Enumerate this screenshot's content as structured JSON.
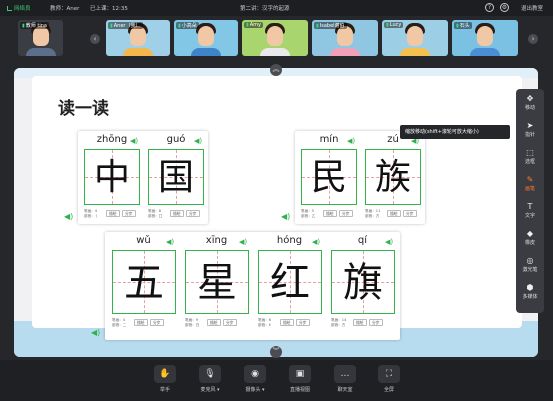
{
  "topbar": {
    "network": "网络良",
    "teacher": "教师：Aner",
    "elapsed": "已上课：12:35",
    "lesson": "第二讲：汉字的起源",
    "help_icon": "?",
    "settings_icon": "gear-icon",
    "exit": "退出教室"
  },
  "students": [
    {
      "name": "教师 tina",
      "shirt": "#5c6f8a",
      "bg": "#3b3d44"
    },
    {
      "name": "Aner（我）",
      "shirt": "#f2b84b",
      "bg": "#9fd0e8"
    },
    {
      "name": "小高朵",
      "shirt": "#3f83c9",
      "bg": "#83c7e6"
    },
    {
      "name": "Amy",
      "shirt": "#e9e9e9",
      "bg": "#a9d56e"
    },
    {
      "name": "Isabel谢伯",
      "shirt": "#f0a0b8",
      "bg": "#8fc6e2"
    },
    {
      "name": "Lucy",
      "shirt": "#f4c04e",
      "bg": "#9ccfe6"
    },
    {
      "name": "石头",
      "shirt": "#4a8fd6",
      "bg": "#7bc1e3"
    }
  ],
  "nav": {
    "prev": "‹",
    "next": "›"
  },
  "slide": {
    "title": "读一读",
    "cards": [
      {
        "cells": [
          {
            "pinyin": "zhōng",
            "char": "中"
          },
          {
            "pinyin": "guó",
            "char": "国"
          }
        ],
        "meta": [
          {
            "line1": "笔画：4",
            "line2": "部首：丨"
          },
          {
            "line1": "笔画：8",
            "line2": "部首：囗"
          }
        ]
      },
      {
        "cells": [
          {
            "pinyin": "mín",
            "char": "民"
          },
          {
            "pinyin": "zú",
            "char": "族"
          }
        ],
        "meta": [
          {
            "line1": "笔画：5",
            "line2": "部首：乙"
          },
          {
            "line1": "笔画：11",
            "line2": "部首：方"
          }
        ]
      },
      {
        "cells": [
          {
            "pinyin": "wǔ",
            "char": "五"
          },
          {
            "pinyin": "xīng",
            "char": "星"
          },
          {
            "pinyin": "hóng",
            "char": "红"
          },
          {
            "pinyin": "qí",
            "char": "旗"
          }
        ],
        "meta": [
          {
            "line1": "笔画：4",
            "line2": "部首：二"
          },
          {
            "line1": "笔画：9",
            "line2": "部首：日"
          },
          {
            "line1": "笔画：6",
            "line2": "部首：纟"
          },
          {
            "line1": "笔画：14",
            "line2": "部首：方"
          }
        ]
      }
    ],
    "btn_trace": "描绘",
    "btn_step": "分步"
  },
  "tooltip": "缩放移动(shift+滚轮可放大缩小)",
  "tools": [
    {
      "label": "移动",
      "icon": "✥"
    },
    {
      "label": "指针",
      "icon": "➤"
    },
    {
      "label": "选框",
      "icon": "⬚"
    },
    {
      "label": "画笔",
      "icon": "✎"
    },
    {
      "label": "文字",
      "icon": "T"
    },
    {
      "label": "橡皮",
      "icon": "◆"
    },
    {
      "label": "激光笔",
      "icon": "◎"
    },
    {
      "label": "多媒体",
      "icon": "⬢"
    }
  ],
  "bottom": [
    {
      "label": "举手",
      "icon": "✋"
    },
    {
      "label": "麦克风 ▾",
      "icon": "🎙"
    },
    {
      "label": "摄像头 ▾",
      "icon": "◉"
    },
    {
      "label": "直播视图",
      "icon": "▣"
    },
    {
      "label": "聊天室",
      "icon": "…"
    },
    {
      "label": "全屏",
      "icon": "⛶"
    }
  ],
  "collapse_up": "︽",
  "collapse_down": "︾"
}
